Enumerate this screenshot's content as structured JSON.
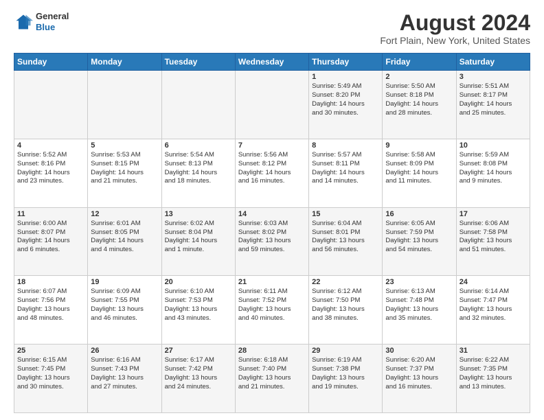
{
  "header": {
    "logo_line1": "General",
    "logo_line2": "Blue",
    "main_title": "August 2024",
    "subtitle": "Fort Plain, New York, United States"
  },
  "days_of_week": [
    "Sunday",
    "Monday",
    "Tuesday",
    "Wednesday",
    "Thursday",
    "Friday",
    "Saturday"
  ],
  "weeks": [
    [
      {
        "day": "",
        "info": ""
      },
      {
        "day": "",
        "info": ""
      },
      {
        "day": "",
        "info": ""
      },
      {
        "day": "",
        "info": ""
      },
      {
        "day": "1",
        "info": "Sunrise: 5:49 AM\nSunset: 8:20 PM\nDaylight: 14 hours\nand 30 minutes."
      },
      {
        "day": "2",
        "info": "Sunrise: 5:50 AM\nSunset: 8:18 PM\nDaylight: 14 hours\nand 28 minutes."
      },
      {
        "day": "3",
        "info": "Sunrise: 5:51 AM\nSunset: 8:17 PM\nDaylight: 14 hours\nand 25 minutes."
      }
    ],
    [
      {
        "day": "4",
        "info": "Sunrise: 5:52 AM\nSunset: 8:16 PM\nDaylight: 14 hours\nand 23 minutes."
      },
      {
        "day": "5",
        "info": "Sunrise: 5:53 AM\nSunset: 8:15 PM\nDaylight: 14 hours\nand 21 minutes."
      },
      {
        "day": "6",
        "info": "Sunrise: 5:54 AM\nSunset: 8:13 PM\nDaylight: 14 hours\nand 18 minutes."
      },
      {
        "day": "7",
        "info": "Sunrise: 5:56 AM\nSunset: 8:12 PM\nDaylight: 14 hours\nand 16 minutes."
      },
      {
        "day": "8",
        "info": "Sunrise: 5:57 AM\nSunset: 8:11 PM\nDaylight: 14 hours\nand 14 minutes."
      },
      {
        "day": "9",
        "info": "Sunrise: 5:58 AM\nSunset: 8:09 PM\nDaylight: 14 hours\nand 11 minutes."
      },
      {
        "day": "10",
        "info": "Sunrise: 5:59 AM\nSunset: 8:08 PM\nDaylight: 14 hours\nand 9 minutes."
      }
    ],
    [
      {
        "day": "11",
        "info": "Sunrise: 6:00 AM\nSunset: 8:07 PM\nDaylight: 14 hours\nand 6 minutes."
      },
      {
        "day": "12",
        "info": "Sunrise: 6:01 AM\nSunset: 8:05 PM\nDaylight: 14 hours\nand 4 minutes."
      },
      {
        "day": "13",
        "info": "Sunrise: 6:02 AM\nSunset: 8:04 PM\nDaylight: 14 hours\nand 1 minute."
      },
      {
        "day": "14",
        "info": "Sunrise: 6:03 AM\nSunset: 8:02 PM\nDaylight: 13 hours\nand 59 minutes."
      },
      {
        "day": "15",
        "info": "Sunrise: 6:04 AM\nSunset: 8:01 PM\nDaylight: 13 hours\nand 56 minutes."
      },
      {
        "day": "16",
        "info": "Sunrise: 6:05 AM\nSunset: 7:59 PM\nDaylight: 13 hours\nand 54 minutes."
      },
      {
        "day": "17",
        "info": "Sunrise: 6:06 AM\nSunset: 7:58 PM\nDaylight: 13 hours\nand 51 minutes."
      }
    ],
    [
      {
        "day": "18",
        "info": "Sunrise: 6:07 AM\nSunset: 7:56 PM\nDaylight: 13 hours\nand 48 minutes."
      },
      {
        "day": "19",
        "info": "Sunrise: 6:09 AM\nSunset: 7:55 PM\nDaylight: 13 hours\nand 46 minutes."
      },
      {
        "day": "20",
        "info": "Sunrise: 6:10 AM\nSunset: 7:53 PM\nDaylight: 13 hours\nand 43 minutes."
      },
      {
        "day": "21",
        "info": "Sunrise: 6:11 AM\nSunset: 7:52 PM\nDaylight: 13 hours\nand 40 minutes."
      },
      {
        "day": "22",
        "info": "Sunrise: 6:12 AM\nSunset: 7:50 PM\nDaylight: 13 hours\nand 38 minutes."
      },
      {
        "day": "23",
        "info": "Sunrise: 6:13 AM\nSunset: 7:48 PM\nDaylight: 13 hours\nand 35 minutes."
      },
      {
        "day": "24",
        "info": "Sunrise: 6:14 AM\nSunset: 7:47 PM\nDaylight: 13 hours\nand 32 minutes."
      }
    ],
    [
      {
        "day": "25",
        "info": "Sunrise: 6:15 AM\nSunset: 7:45 PM\nDaylight: 13 hours\nand 30 minutes."
      },
      {
        "day": "26",
        "info": "Sunrise: 6:16 AM\nSunset: 7:43 PM\nDaylight: 13 hours\nand 27 minutes."
      },
      {
        "day": "27",
        "info": "Sunrise: 6:17 AM\nSunset: 7:42 PM\nDaylight: 13 hours\nand 24 minutes."
      },
      {
        "day": "28",
        "info": "Sunrise: 6:18 AM\nSunset: 7:40 PM\nDaylight: 13 hours\nand 21 minutes."
      },
      {
        "day": "29",
        "info": "Sunrise: 6:19 AM\nSunset: 7:38 PM\nDaylight: 13 hours\nand 19 minutes."
      },
      {
        "day": "30",
        "info": "Sunrise: 6:20 AM\nSunset: 7:37 PM\nDaylight: 13 hours\nand 16 minutes."
      },
      {
        "day": "31",
        "info": "Sunrise: 6:22 AM\nSunset: 7:35 PM\nDaylight: 13 hours\nand 13 minutes."
      }
    ]
  ]
}
